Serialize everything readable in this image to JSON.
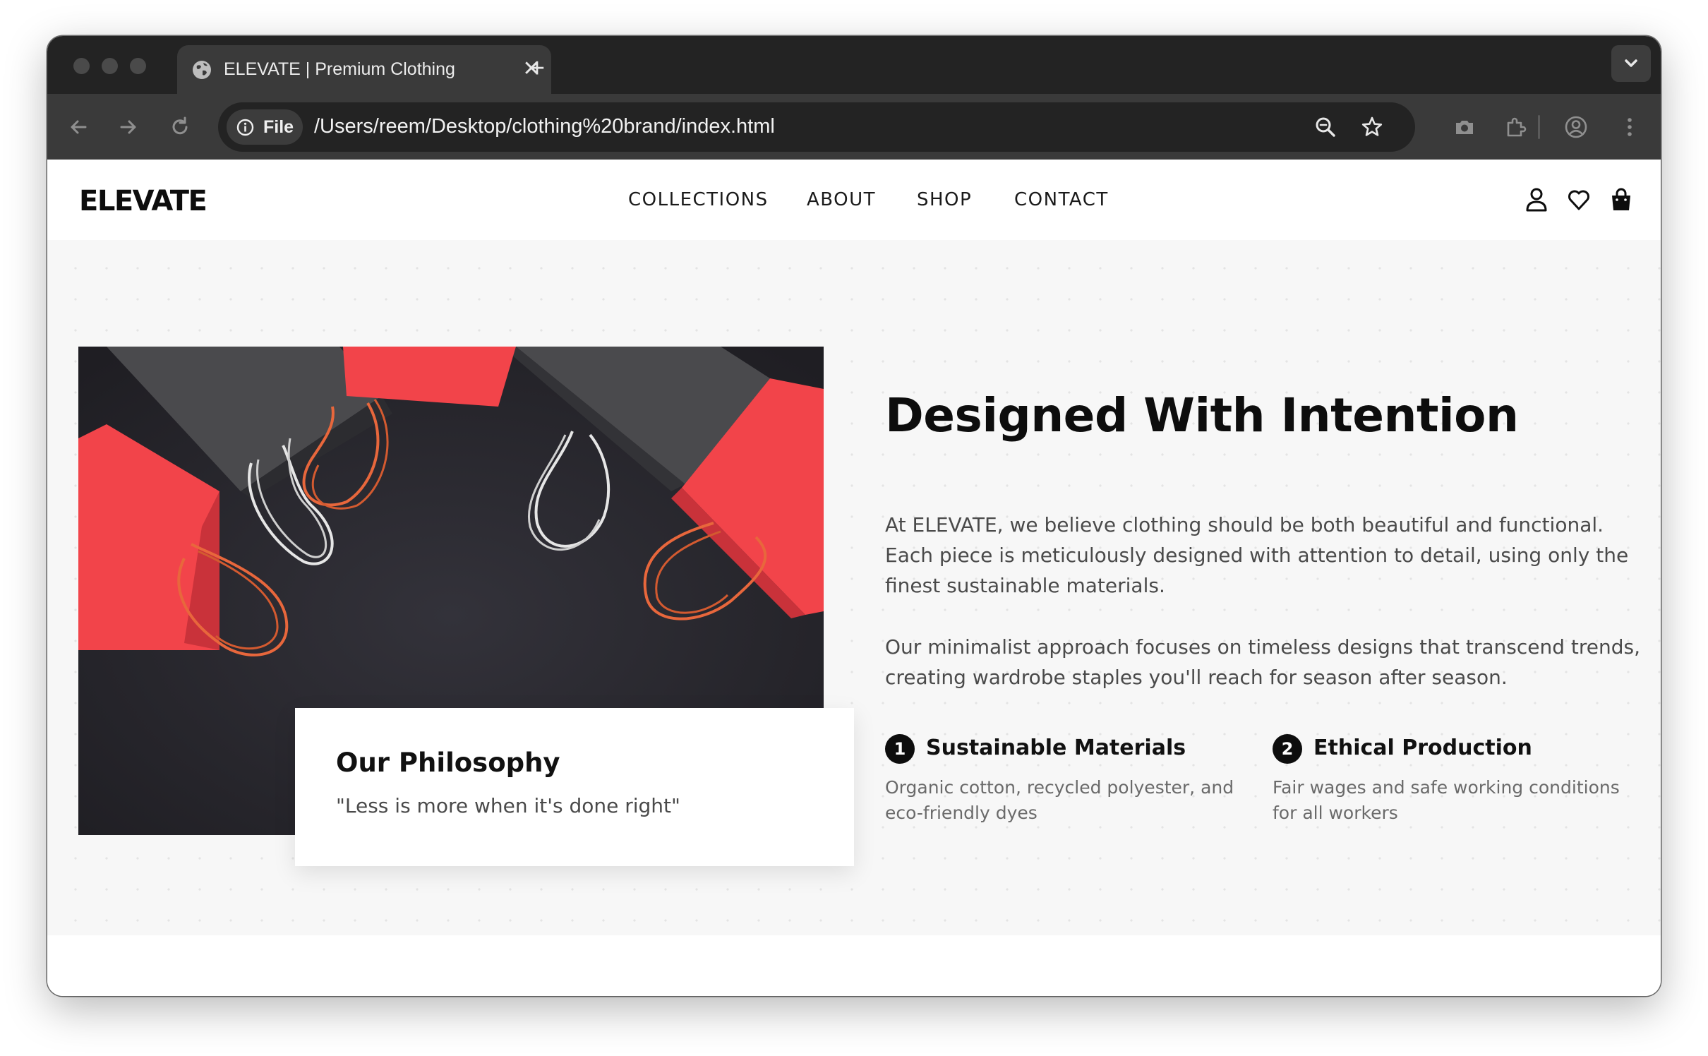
{
  "browser": {
    "tab_title": "ELEVATE | Premium Clothing",
    "chip_label": "File",
    "url": "/Users/reem/Desktop/clothing%20brand/index.html",
    "icons": [
      "globe-icon",
      "close-icon",
      "plus-icon",
      "chevron-down-icon",
      "back-icon",
      "forward-icon",
      "reload-icon",
      "info-icon",
      "zoom-icon",
      "star-icon",
      "camera-icon",
      "extensions-icon",
      "profile-icon",
      "menu-icon"
    ]
  },
  "site": {
    "logo": "ELEVATE",
    "nav": [
      "COLLECTIONS",
      "ABOUT",
      "SHOP",
      "CONTACT"
    ],
    "nav_icons": [
      "user-icon",
      "heart-icon",
      "bag-icon"
    ]
  },
  "hero": {
    "heading": "Designed With Intention",
    "paragraph_1": "At ELEVATE, we believe clothing should be both beautiful and functional. Each piece is meticulously designed with attention to detail, using only the finest sustainable materials.",
    "paragraph_2": "Our minimalist approach focuses on timeless designs that transcend trends, creating wardrobe staples you'll reach for season after season.",
    "card": {
      "title": "Our Philosophy",
      "quote": "\"Less is more when it's done right\""
    },
    "features": [
      {
        "number": "1",
        "title": "Sustainable Materials",
        "description": "Organic cotton, recycled polyester, and eco-friendly dyes"
      },
      {
        "number": "2",
        "title": "Ethical Production",
        "description": "Fair wages and safe working conditions for all workers"
      }
    ]
  },
  "colors": {
    "accent_red": "#f2444a",
    "dark": "#0d0d0d",
    "text_gray": "#4a4a4a"
  }
}
